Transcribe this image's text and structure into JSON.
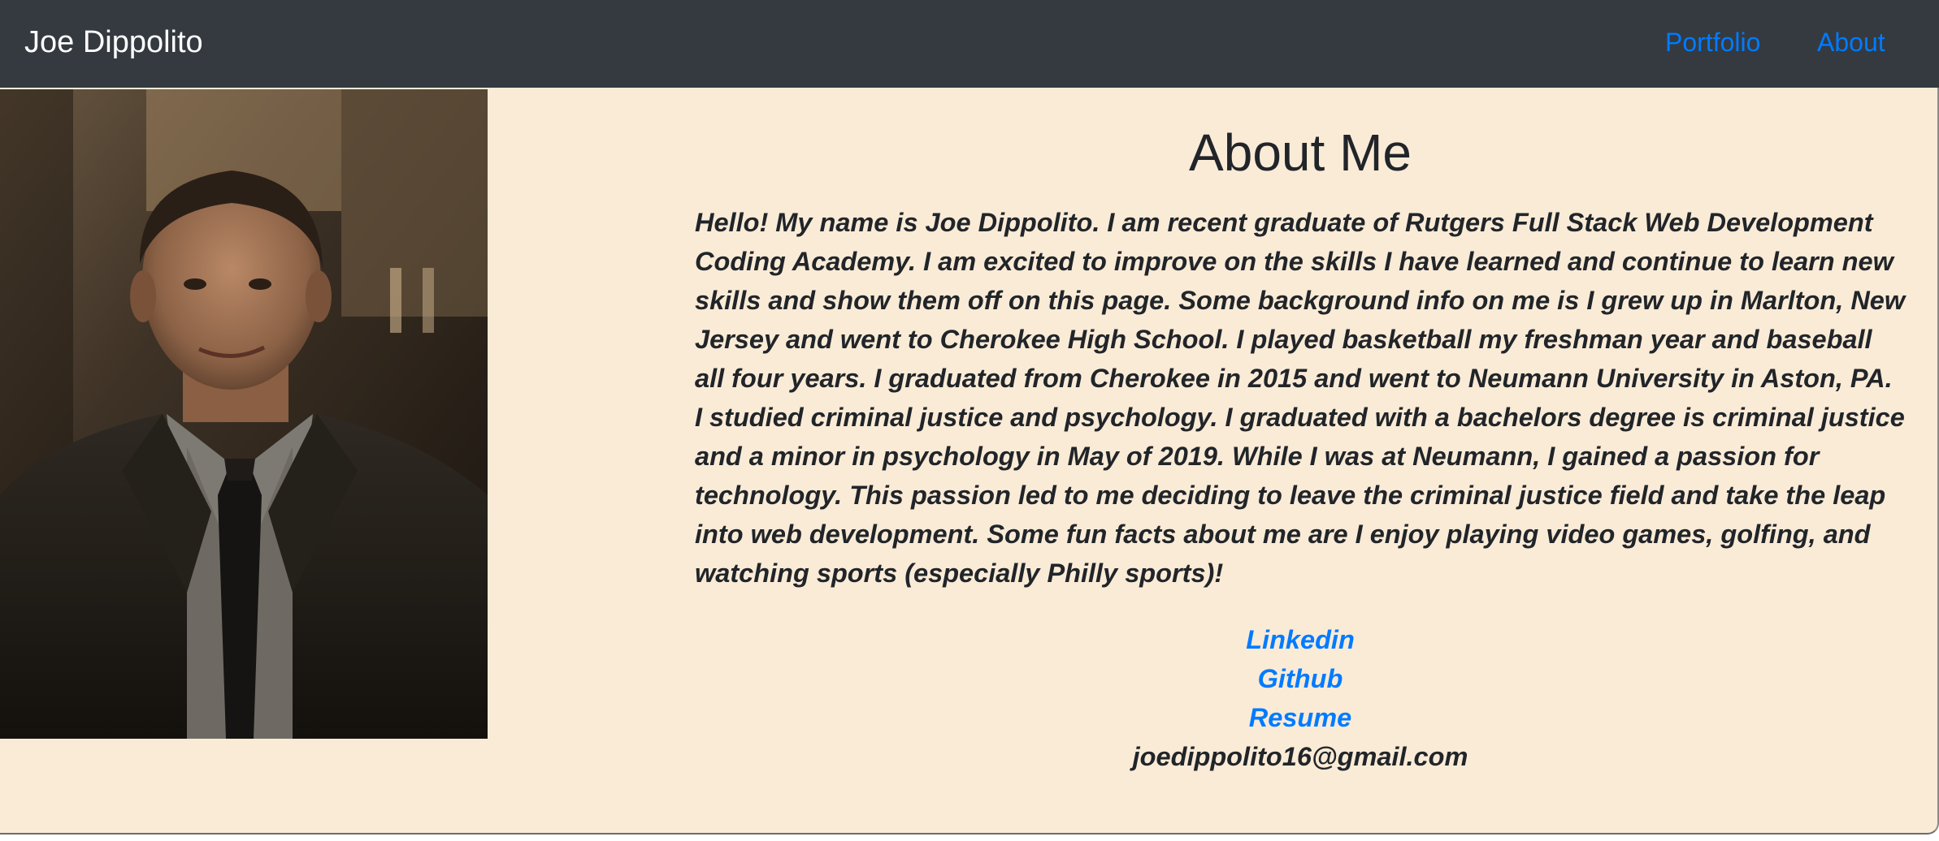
{
  "navbar": {
    "brand": "Joe Dippolito",
    "links": [
      "Portfolio",
      "About"
    ],
    "link_color": "#007bff",
    "background": "#343a40"
  },
  "about": {
    "title": "About Me",
    "bio": "Hello! My name is Joe Dippolito. I am recent graduate of Rutgers Full Stack Web Development Coding Academy. I am excited to improve on the skills I have learned and continue to learn new skills and show them off on this page. Some background info on me is I grew up in Marlton, New Jersey and went to Cherokee High School. I played basketball my freshman year and baseball all four years. I graduated from Cherokee in 2015 and went to Neumann University in Aston, PA. I studied criminal justice and psychology. I graduated with a bachelors degree is criminal justice and a minor in psychology in May of 2019. While I was at Neumann, I gained a passion for technology. This passion led to me deciding to leave the criminal justice field and take the leap into web development. Some fun facts about me are I enjoy playing video games, golfing, and watching sports (especially Philly sports)!",
    "links": [
      "Linkedin",
      "Github",
      "Resume"
    ],
    "email": "joedippolito16@gmail.com",
    "background": "#faebd7"
  },
  "photo": {
    "subject": "portrait-photo"
  }
}
